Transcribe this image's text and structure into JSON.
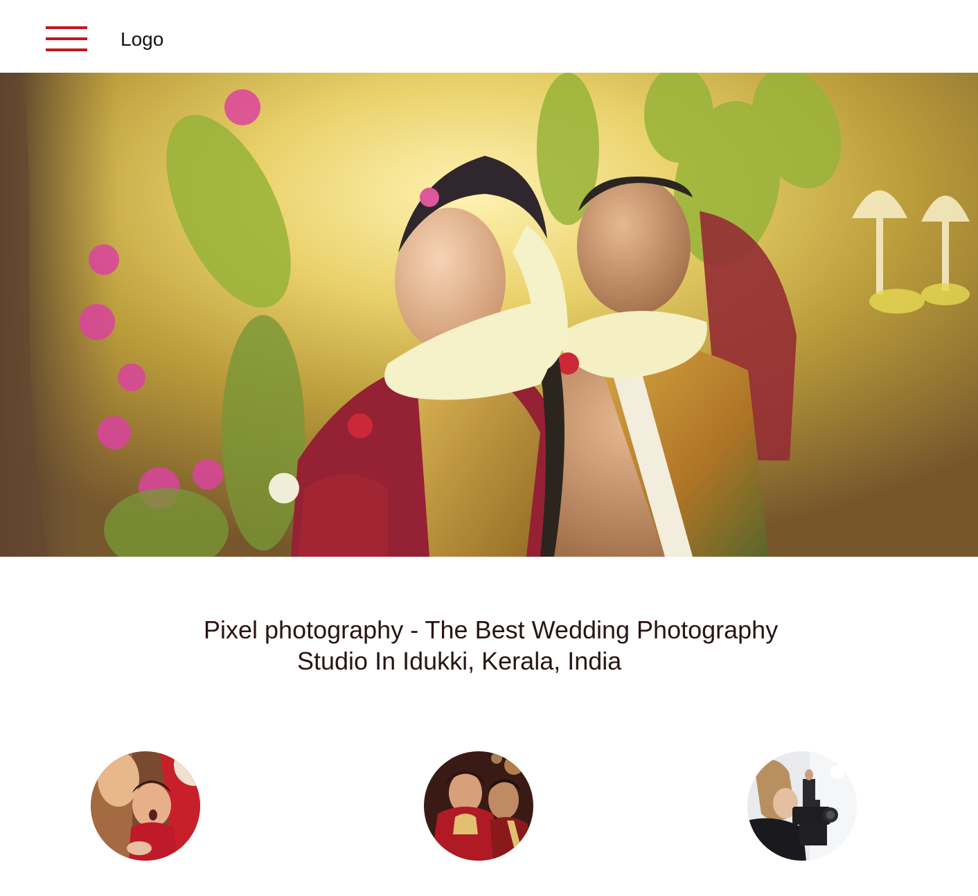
{
  "header": {
    "logo_text": "Logo",
    "menu_icon": "hamburger-menu-icon",
    "menu_color": "#c4161c"
  },
  "hero": {
    "image": "wedding-couple-photo"
  },
  "tagline": {
    "line1": "Pixel photography - The Best Wedding Photography",
    "line2": "Studio In Idukki, Kerala, India"
  },
  "services": [
    {
      "image": "child-portrait-photo"
    },
    {
      "image": "bridal-couple-photo"
    },
    {
      "image": "videographer-photo"
    }
  ]
}
